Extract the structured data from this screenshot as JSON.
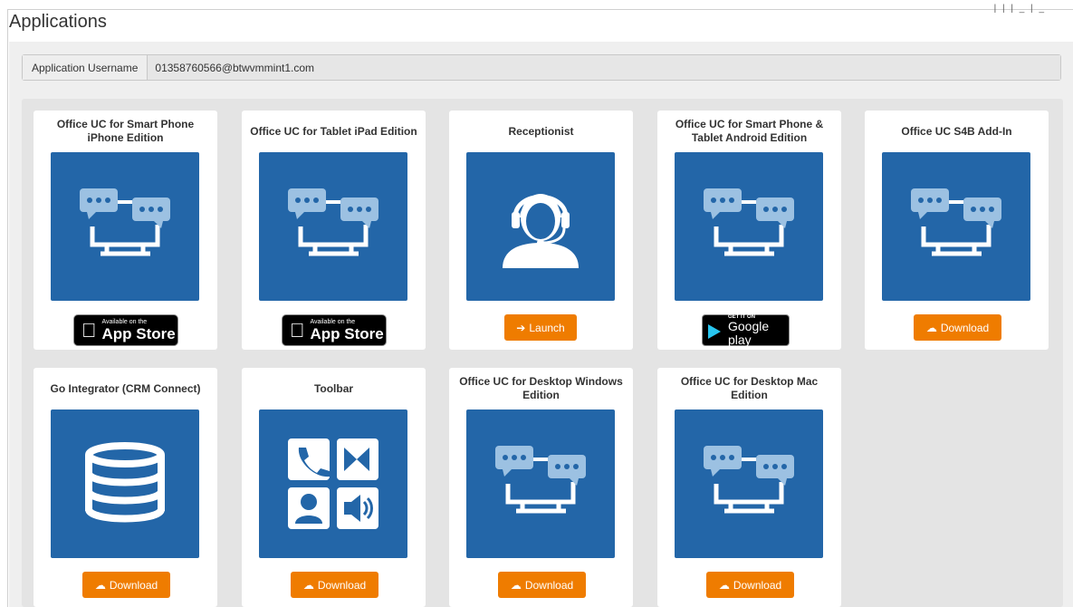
{
  "page": {
    "title": "Applications",
    "topright": "| |  | _ | _"
  },
  "user": {
    "label": "Application Username",
    "value": "01358760566@btwvmmint1.com"
  },
  "apps": [
    {
      "title": "Office UC for Smart Phone iPhone Edition",
      "icon": "chat-monitor-icon",
      "action": "app-store",
      "store_small": "Available on the",
      "store_big": "App Store"
    },
    {
      "title": "Office UC for Tablet iPad Edition",
      "icon": "chat-monitor-icon",
      "action": "app-store",
      "store_small": "Available on the",
      "store_big": "App Store"
    },
    {
      "title": "Receptionist",
      "icon": "headset-agent-icon",
      "action": "launch",
      "button": "Launch"
    },
    {
      "title": "Office UC for Smart Phone & Tablet Android Edition",
      "icon": "chat-monitor-icon",
      "action": "google-play",
      "store_small": "GET IT ON",
      "store_big": "Google play"
    },
    {
      "title": "Office UC S4B Add-In",
      "icon": "chat-monitor-icon",
      "action": "download",
      "button": "Download"
    },
    {
      "title": "Go Integrator (CRM Connect)",
      "icon": "database-icon",
      "action": "download",
      "button": "Download"
    },
    {
      "title": "Toolbar",
      "icon": "toolbar-grid-icon",
      "action": "download",
      "button": "Download"
    },
    {
      "title": "Office UC for Desktop Windows Edition",
      "icon": "chat-monitor-icon",
      "action": "download",
      "button": "Download"
    },
    {
      "title": "Office UC for Desktop Mac Edition",
      "icon": "chat-monitor-icon",
      "action": "download",
      "button": "Download"
    }
  ],
  "colors": {
    "tile": "#2366a8",
    "button": "#ef7c00",
    "panel": "#e4e4e4"
  }
}
